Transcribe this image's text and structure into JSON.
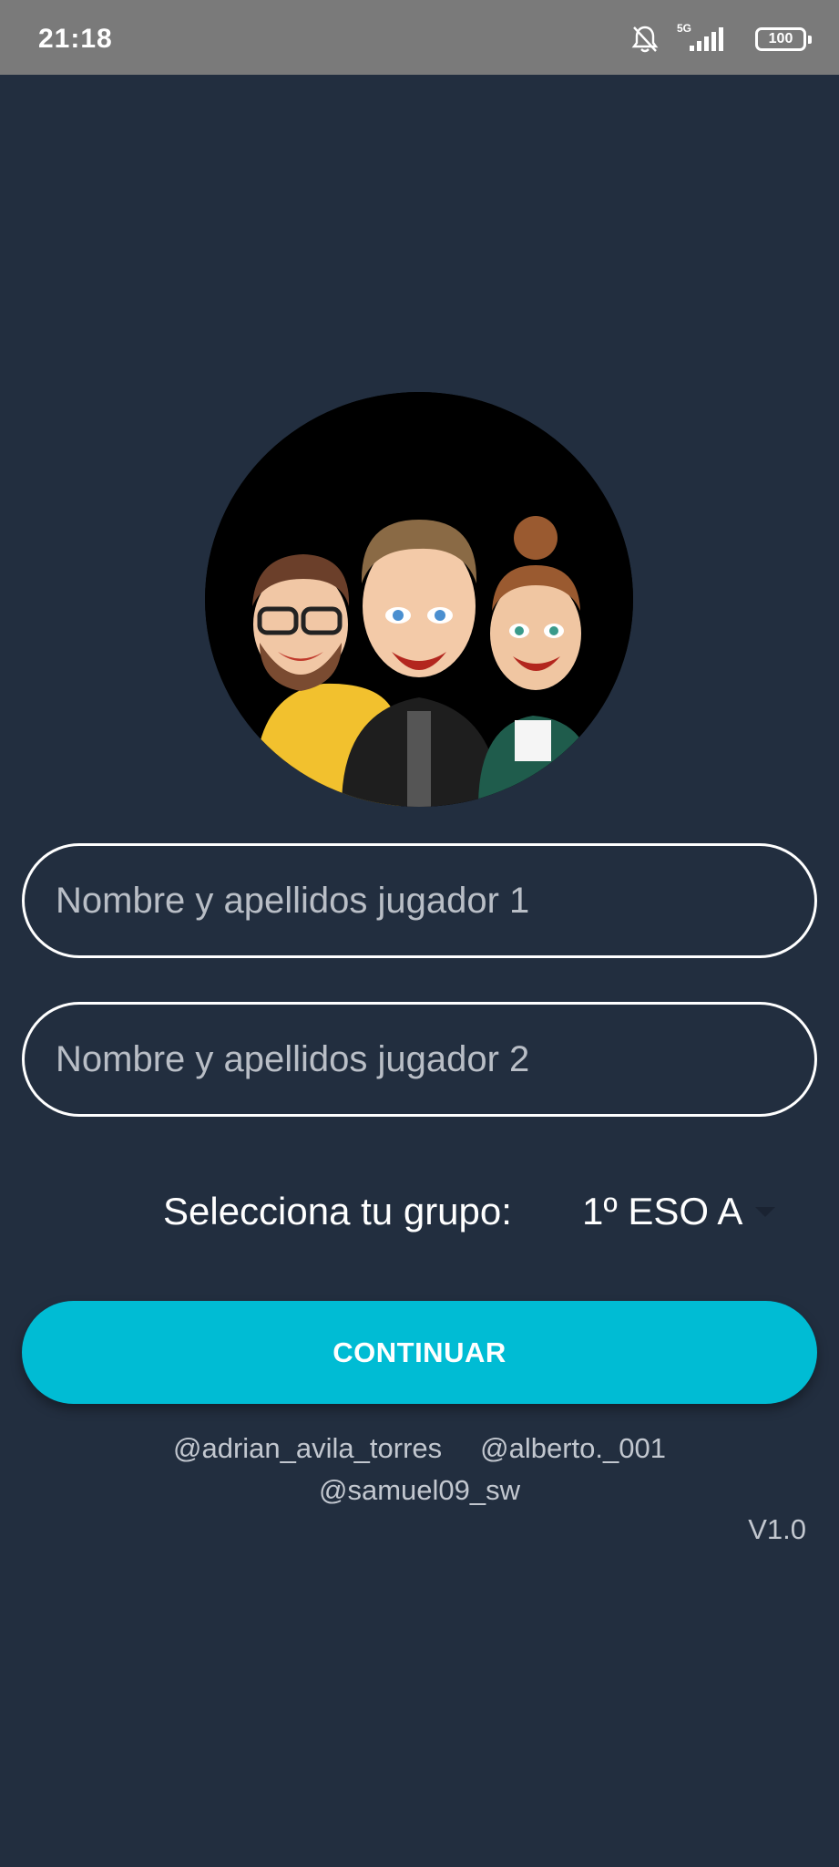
{
  "status_bar": {
    "time": "21:18",
    "network_label": "5G",
    "battery": "100",
    "icons": [
      "bell-off-icon",
      "signal-icon",
      "battery-icon"
    ]
  },
  "form": {
    "player1_placeholder": "Nombre y apellidos jugador 1",
    "player2_placeholder": "Nombre y apellidos jugador 2",
    "group_label": "Selecciona tu grupo:",
    "group_value": "1º ESO A",
    "continue_label": "CONTINUAR"
  },
  "credits": {
    "user1": "@adrian_avila_torres",
    "user2": "@alberto._001",
    "user3": "@samuel09_sw"
  },
  "version": "V1.0",
  "colors": {
    "background": "#222e3f",
    "accent": "#00bcd4",
    "status_bar": "#7a7a7a"
  }
}
